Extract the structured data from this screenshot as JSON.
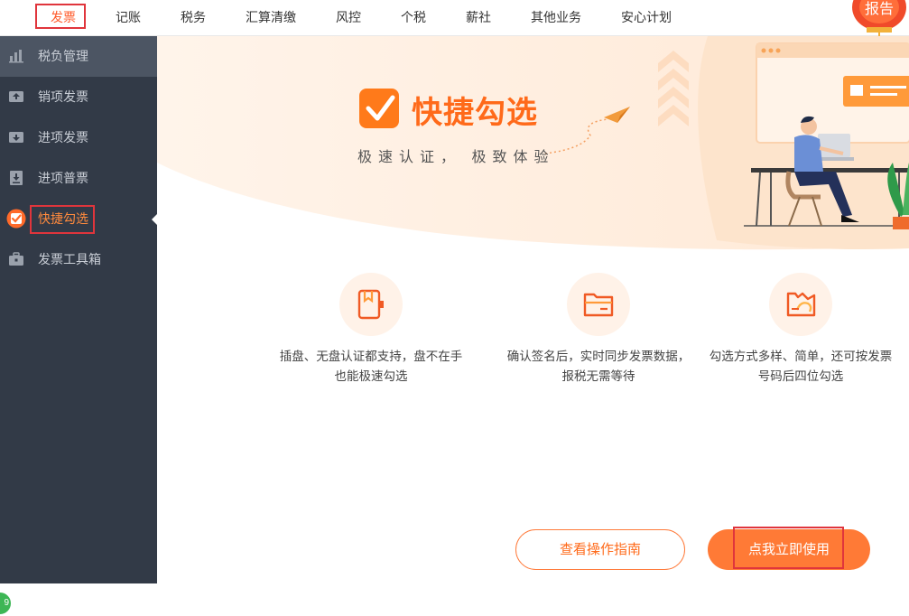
{
  "topnav": {
    "items": [
      "发票",
      "记账",
      "税务",
      "汇算清缴",
      "风控",
      "个税",
      "薪社",
      "其他业务",
      "安心计划"
    ],
    "badge": "报告"
  },
  "sidebar": {
    "items": [
      {
        "label": "税负管理",
        "icon": "bar-chart-icon"
      },
      {
        "label": "销项发票",
        "icon": "invoice-out-icon"
      },
      {
        "label": "进项发票",
        "icon": "invoice-in-icon"
      },
      {
        "label": "进项普票",
        "icon": "download-icon"
      },
      {
        "label": "快捷勾选",
        "icon": "check-icon"
      },
      {
        "label": "发票工具箱",
        "icon": "toolbox-icon"
      }
    ],
    "active_index": 4,
    "corner_badge": "9"
  },
  "banner": {
    "title": "快捷勾选",
    "subtitle": "极速认证，  极致体验"
  },
  "features": [
    {
      "icon": "usb-key-icon",
      "text": "插盘、无盘认证都支持，盘不在手也能极速勾选"
    },
    {
      "icon": "folder-icon",
      "text": "确认签名后，实时同步发票数据，报税无需等待"
    },
    {
      "icon": "selection-methods-icon",
      "text": "勾选方式多样、简单，还可按发票号码后四位勾选"
    }
  ],
  "buttons": {
    "guide": "查看操作指南",
    "use": "点我立即使用"
  },
  "colors": {
    "accent": "#ff7a36",
    "sidebar_bg": "#323a47",
    "highlight_box": "#e0353c"
  }
}
